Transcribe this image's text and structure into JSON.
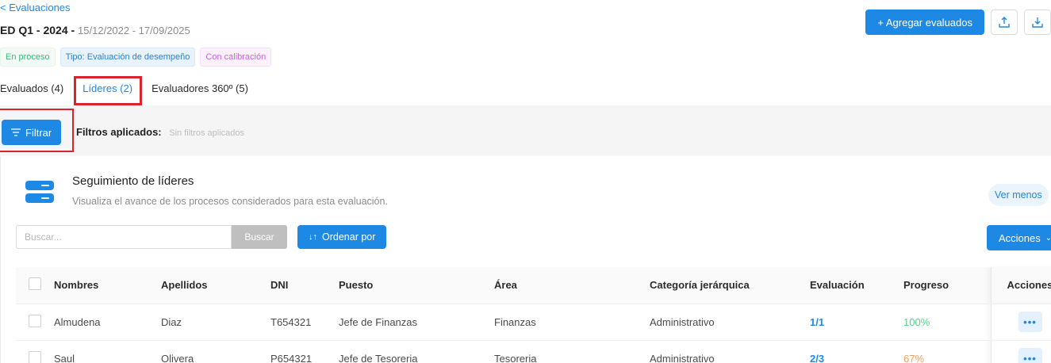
{
  "header": {
    "back_label": "< Evaluaciones",
    "title": "ED Q1 - 2024 -",
    "dates": "15/12/2022 - 17/09/2025",
    "add_button": "+ Agregar evaluados"
  },
  "tags": [
    {
      "label": "En proceso",
      "color": "#3bb77e"
    },
    {
      "label": "Tipo: Evaluación de desempeño",
      "color": "#2f7fd8"
    },
    {
      "label": "Con calibración",
      "color": "#c766e8"
    }
  ],
  "tabs": [
    {
      "label": "Evaluados (4)",
      "active": false
    },
    {
      "label": "Líderes (2)",
      "active": true
    },
    {
      "label": "Evaluadores 360º (5)",
      "active": false
    }
  ],
  "filters": {
    "button": "Filtrar",
    "label": "Filtros aplicados:",
    "value": "Sin filtros aplicados"
  },
  "card": {
    "title": "Seguimiento de líderes",
    "subtitle": "Visualiza el avance de los procesos considerados para esta evaluación.",
    "toggle": "Ver menos"
  },
  "toolbar": {
    "search_placeholder": "Buscar...",
    "search_button": "Buscar",
    "sort_button": "Ordenar por",
    "actions_button": "Acciones"
  },
  "table": {
    "columns": [
      "Nombres",
      "Apellidos",
      "DNI",
      "Puesto",
      "Área",
      "Categoría jerárquica",
      "Evaluación",
      "Progreso",
      "Acciones"
    ],
    "rows": [
      {
        "nombres": "Almudena",
        "apellidos": "Diaz",
        "dni": "T654321",
        "puesto": "Jefe de Finanzas",
        "area": "Finanzas",
        "categoria": "Administrativo",
        "evaluacion": "1/1",
        "progreso": "100%"
      },
      {
        "nombres": "Saul",
        "apellidos": "Olivera",
        "dni": "P654321",
        "puesto": "Jefe de Tesoreria",
        "area": "Tesoreria",
        "categoria": "Administrativo",
        "evaluacion": "2/3",
        "progreso": "67%"
      }
    ]
  },
  "colors": {
    "primary": "#1e88e5",
    "highlight": "#d9252a",
    "progress_complete": "#5bd08f",
    "progress_partial": "#f5a05b"
  }
}
